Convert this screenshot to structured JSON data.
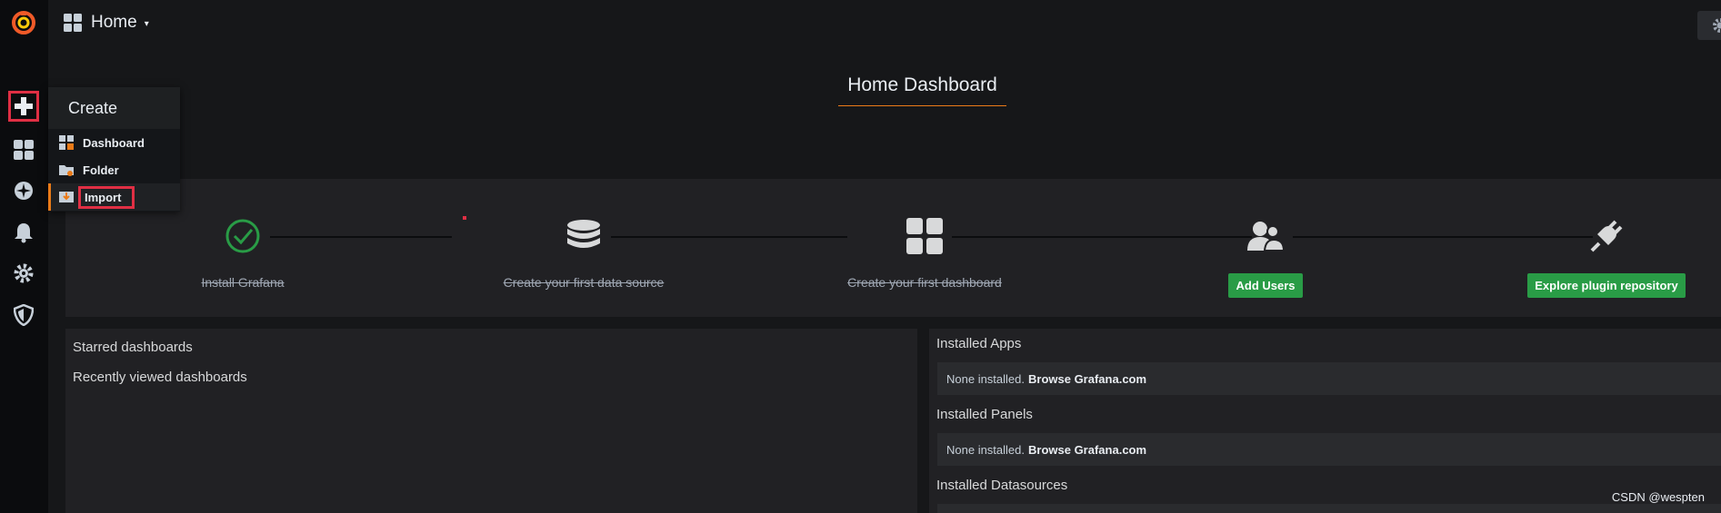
{
  "sidebar": {
    "icons": [
      "grafana-logo",
      "plus-icon",
      "dashboards-icon",
      "explore-icon",
      "alerting-icon",
      "gear-icon",
      "shield-icon"
    ]
  },
  "create_menu": {
    "title": "Create",
    "items": [
      {
        "label": "Dashboard",
        "icon": "dashboard-icon"
      },
      {
        "label": "Folder",
        "icon": "folder-icon"
      },
      {
        "label": "Import",
        "icon": "import-icon"
      }
    ]
  },
  "topbar": {
    "title": "Home",
    "caret": "▾"
  },
  "main": {
    "title": "Home Dashboard",
    "steps": [
      {
        "label": "Install Grafana",
        "done": true,
        "icon": "check-circle-icon"
      },
      {
        "label": "Create your first data source",
        "done": true,
        "icon": "database-icon"
      },
      {
        "label": "Create your first dashboard",
        "done": true,
        "icon": "dashboard-grid-icon"
      },
      {
        "label": "Add Users",
        "done": false,
        "icon": "users-icon"
      },
      {
        "label": "Explore plugin repository",
        "done": false,
        "icon": "plug-icon"
      }
    ],
    "left_panel": {
      "starred": "Starred dashboards",
      "recent": "Recently viewed dashboards"
    },
    "right_panel": {
      "apps_title": "Installed Apps",
      "panels_title": "Installed Panels",
      "datasources_title": "Installed Datasources",
      "none_text": "None installed.",
      "browse_text": "Browse Grafana.com"
    }
  },
  "colors": {
    "accent": "#eb7b18",
    "success": "#299c46",
    "highlight": "#e02f44"
  },
  "watermark": "CSDN @wespten"
}
